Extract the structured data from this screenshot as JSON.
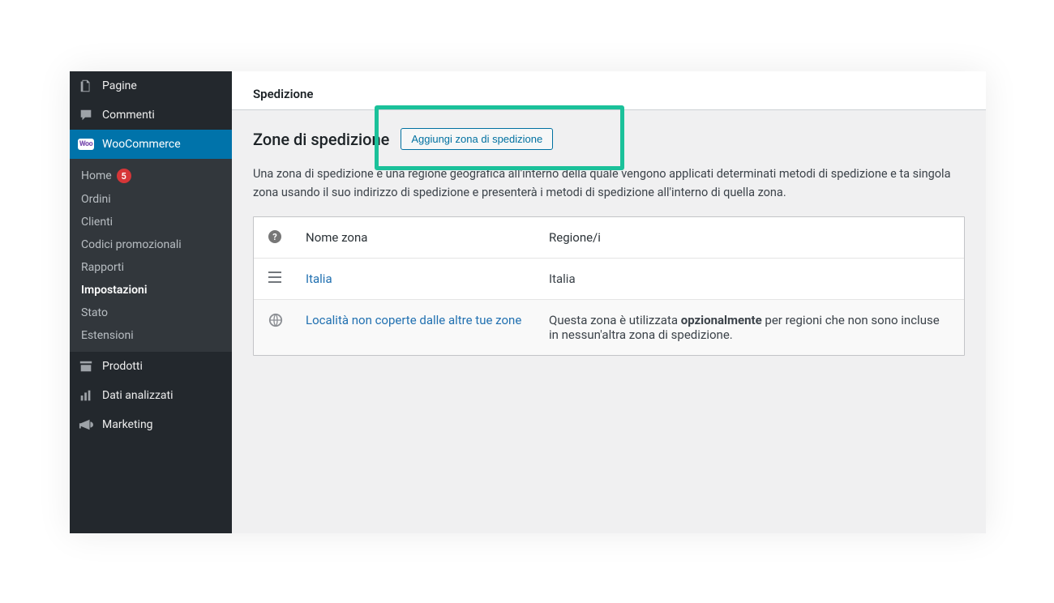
{
  "sidebar": {
    "pagine": "Pagine",
    "commenti": "Commenti",
    "woocommerce": "WooCommerce",
    "prodotti": "Prodotti",
    "dati": "Dati analizzati",
    "marketing": "Marketing",
    "sub": {
      "home": "Home",
      "home_badge": "5",
      "ordini": "Ordini",
      "clienti": "Clienti",
      "codici": "Codici promozionali",
      "rapporti": "Rapporti",
      "impostazioni": "Impostazioni",
      "stato": "Stato",
      "estensioni": "Estensioni"
    }
  },
  "tabs": {
    "spedizione": "Spedizione"
  },
  "page": {
    "heading": "Zone di spedizione",
    "add_button": "Aggiungi zona di spedizione",
    "description": "Una zona di spedizione è una regione geografica all'interno della quale vengono applicati determinati metodi di spedizione e ta singola zona usando il suo indirizzo di spedizione e presenterà i metodi di spedizione all'interno di quella zona."
  },
  "table": {
    "col_name": "Nome zona",
    "col_region": "Regione/i",
    "rows": [
      {
        "name": "Italia",
        "region": "Italia"
      }
    ],
    "rest": {
      "name": "Località non coperte dalle altre tue zone",
      "region_pre": "Questa zona è utilizzata ",
      "region_strong": "opzionalmente",
      "region_post": " per regioni che non sono incluse in nessun'altra zona di spedizione."
    }
  }
}
